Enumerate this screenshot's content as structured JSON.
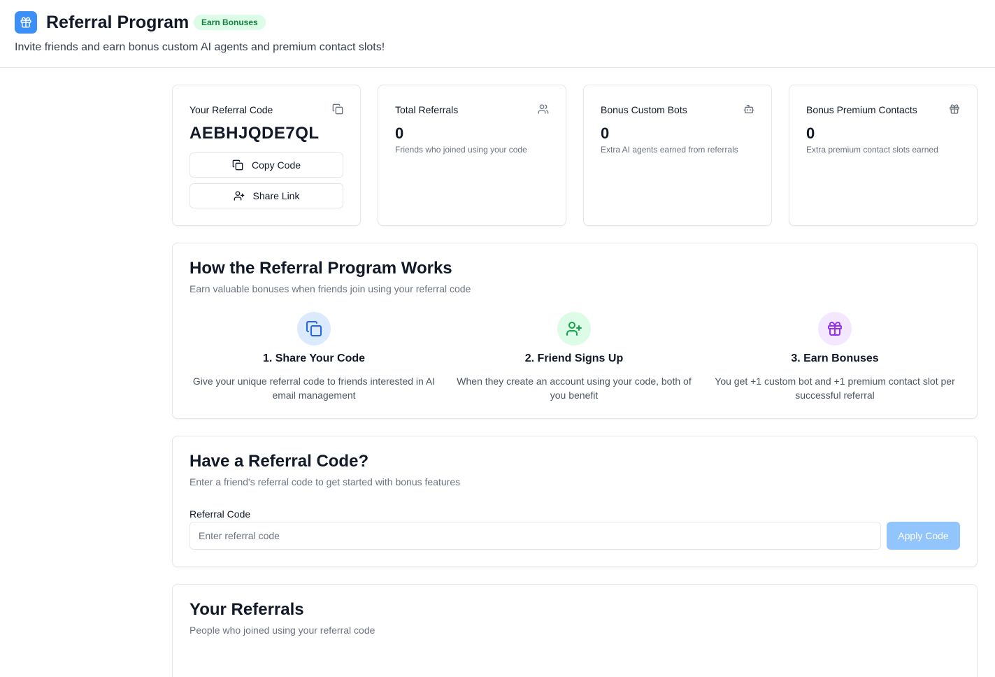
{
  "header": {
    "title": "Referral Program",
    "badge": "Earn Bonuses",
    "subtitle": "Invite friends and earn bonus custom AI agents and premium contact slots!",
    "logo_icon": "gift-icon"
  },
  "stats": {
    "code_card": {
      "label": "Your Referral Code",
      "value": "AEBHJQDE7QL",
      "icon": "copy-icon",
      "copy_label": "Copy Code",
      "share_label": "Share Link"
    },
    "total_referrals": {
      "label": "Total Referrals",
      "value": "0",
      "desc": "Friends who joined using your code",
      "icon": "users-icon"
    },
    "bonus_bots": {
      "label": "Bonus Custom Bots",
      "value": "0",
      "desc": "Extra AI agents earned from referrals",
      "icon": "bot-icon"
    },
    "bonus_contacts": {
      "label": "Bonus Premium Contacts",
      "value": "0",
      "desc": "Extra premium contact slots earned",
      "icon": "gift-icon"
    }
  },
  "how_it_works": {
    "title": "How the Referral Program Works",
    "subtitle": "Earn valuable bonuses when friends join using your referral code",
    "steps": [
      {
        "title": "1. Share Your Code",
        "desc": "Give your unique referral code to friends interested in AI email management",
        "icon": "copy-icon"
      },
      {
        "title": "2. Friend Signs Up",
        "desc": "When they create an account using your code, both of you benefit",
        "icon": "user-plus-icon"
      },
      {
        "title": "3. Earn Bonuses",
        "desc": "You get +1 custom bot and +1 premium contact slot per successful referral",
        "icon": "gift-icon"
      }
    ]
  },
  "have_code": {
    "title": "Have a Referral Code?",
    "subtitle": "Enter a friend's referral code to get started with bonus features",
    "field_label": "Referral Code",
    "placeholder": "Enter referral code",
    "value": "",
    "apply_label": "Apply Code"
  },
  "your_referrals": {
    "title": "Your Referrals",
    "subtitle": "People who joined using your referral code"
  },
  "colors": {
    "primary": "#3b8ff6",
    "badge_bg": "#dcfce7",
    "badge_text": "#15803d",
    "step1_bg": "#dbeafe",
    "step2_bg": "#dcfce7",
    "step3_bg": "#f3e8ff",
    "apply_disabled": "#93c5fd"
  }
}
